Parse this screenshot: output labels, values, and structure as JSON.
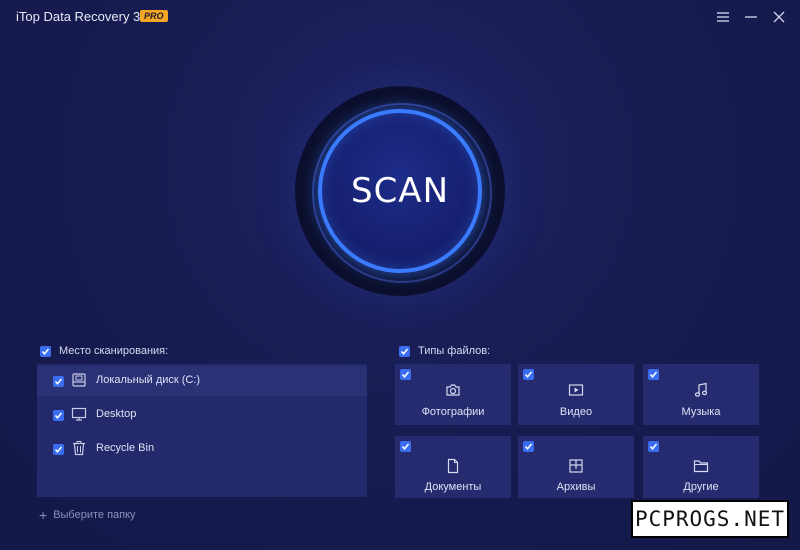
{
  "app": {
    "title": "iTop Data Recovery 3.0",
    "badge": "PRO"
  },
  "scan": {
    "label": "SCAN"
  },
  "locations": {
    "header": "Место сканирования:",
    "items": [
      {
        "label": "Локальный диск (C:)",
        "icon": "disk-icon",
        "checked": true
      },
      {
        "label": "Desktop",
        "icon": "monitor-icon",
        "checked": true
      },
      {
        "label": "Recycle Bin",
        "icon": "trash-icon",
        "checked": true
      }
    ],
    "add_folder": "Выберите папку"
  },
  "file_types": {
    "header": "Типы файлов:",
    "items": [
      {
        "label": "Фотографии",
        "icon": "camera-icon",
        "checked": true
      },
      {
        "label": "Видео",
        "icon": "play-icon",
        "checked": true
      },
      {
        "label": "Музыка",
        "icon": "music-note-icon",
        "checked": true
      },
      {
        "label": "Документы",
        "icon": "document-icon",
        "checked": true
      },
      {
        "label": "Архивы",
        "icon": "archive-icon",
        "checked": true
      },
      {
        "label": "Другие",
        "icon": "folder-icon",
        "checked": true
      }
    ]
  },
  "watermark": "PCPROGS.NET",
  "colors": {
    "accent": "#3a7bff",
    "badge": "#f5a623",
    "background": "#171c52"
  }
}
